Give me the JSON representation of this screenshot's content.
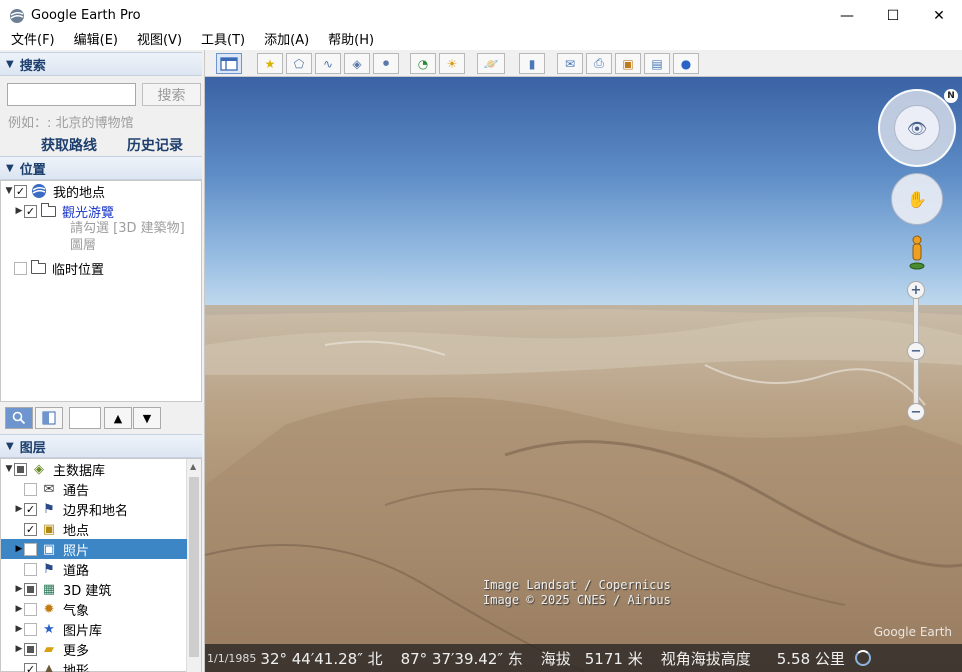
{
  "window": {
    "title": "Google Earth Pro",
    "minimize": "—",
    "maximize": "☐",
    "close": "✕"
  },
  "menu": [
    "文件(F)",
    "编辑(E)",
    "视图(V)",
    "工具(T)",
    "添加(A)",
    "帮助(H)"
  ],
  "search": {
    "header": "搜索",
    "button": "搜索",
    "example": "例如：: 北京的博物馆",
    "directions": "获取路线",
    "history": "历史记录"
  },
  "places": {
    "header": "位置",
    "items": [
      {
        "label": "我的地点",
        "checked": true
      },
      {
        "label": "觀光游覽",
        "checked": true
      },
      {
        "label": "請勾選 [3D 建築物] 圖層",
        "checked": false
      },
      {
        "label": "临时位置",
        "checked": false
      }
    ]
  },
  "layers": {
    "header": "图层",
    "items": [
      {
        "label": "主数据库",
        "state": "partial",
        "icon": "layers-icon"
      },
      {
        "label": "通告",
        "state": "unchecked",
        "icon": "mail-icon"
      },
      {
        "label": "边界和地名",
        "state": "checked",
        "icon": "flag-icon"
      },
      {
        "label": "地点",
        "state": "checked",
        "icon": "place-icon"
      },
      {
        "label": "照片",
        "state": "unchecked",
        "icon": "photo-icon",
        "selected": true
      },
      {
        "label": "道路",
        "state": "unchecked",
        "icon": "road-icon"
      },
      {
        "label": "3D 建筑",
        "state": "partial",
        "icon": "building-icon"
      },
      {
        "label": "气象",
        "state": "unchecked",
        "icon": "weather-icon"
      },
      {
        "label": "图片库",
        "state": "unchecked",
        "icon": "gallery-icon"
      },
      {
        "label": "更多",
        "state": "partial",
        "icon": "more-icon"
      },
      {
        "label": "地形",
        "state": "checked",
        "icon": "terrain-icon"
      }
    ]
  },
  "view": {
    "attribution_1": "Image Landsat / Copernicus",
    "attribution_2": "Image © 2025 CNES / Airbus",
    "watermark": "Google Earth",
    "nav_n": "N"
  },
  "status": {
    "date": "1/1/1985",
    "lat": "32° 44′41.28″ 北",
    "lon": "87° 37′39.42″ 东",
    "elev_label": "海拔",
    "elev_value": "5171 米",
    "eye_label": "视角海拔高度",
    "eye_value": "5.58 公里"
  }
}
